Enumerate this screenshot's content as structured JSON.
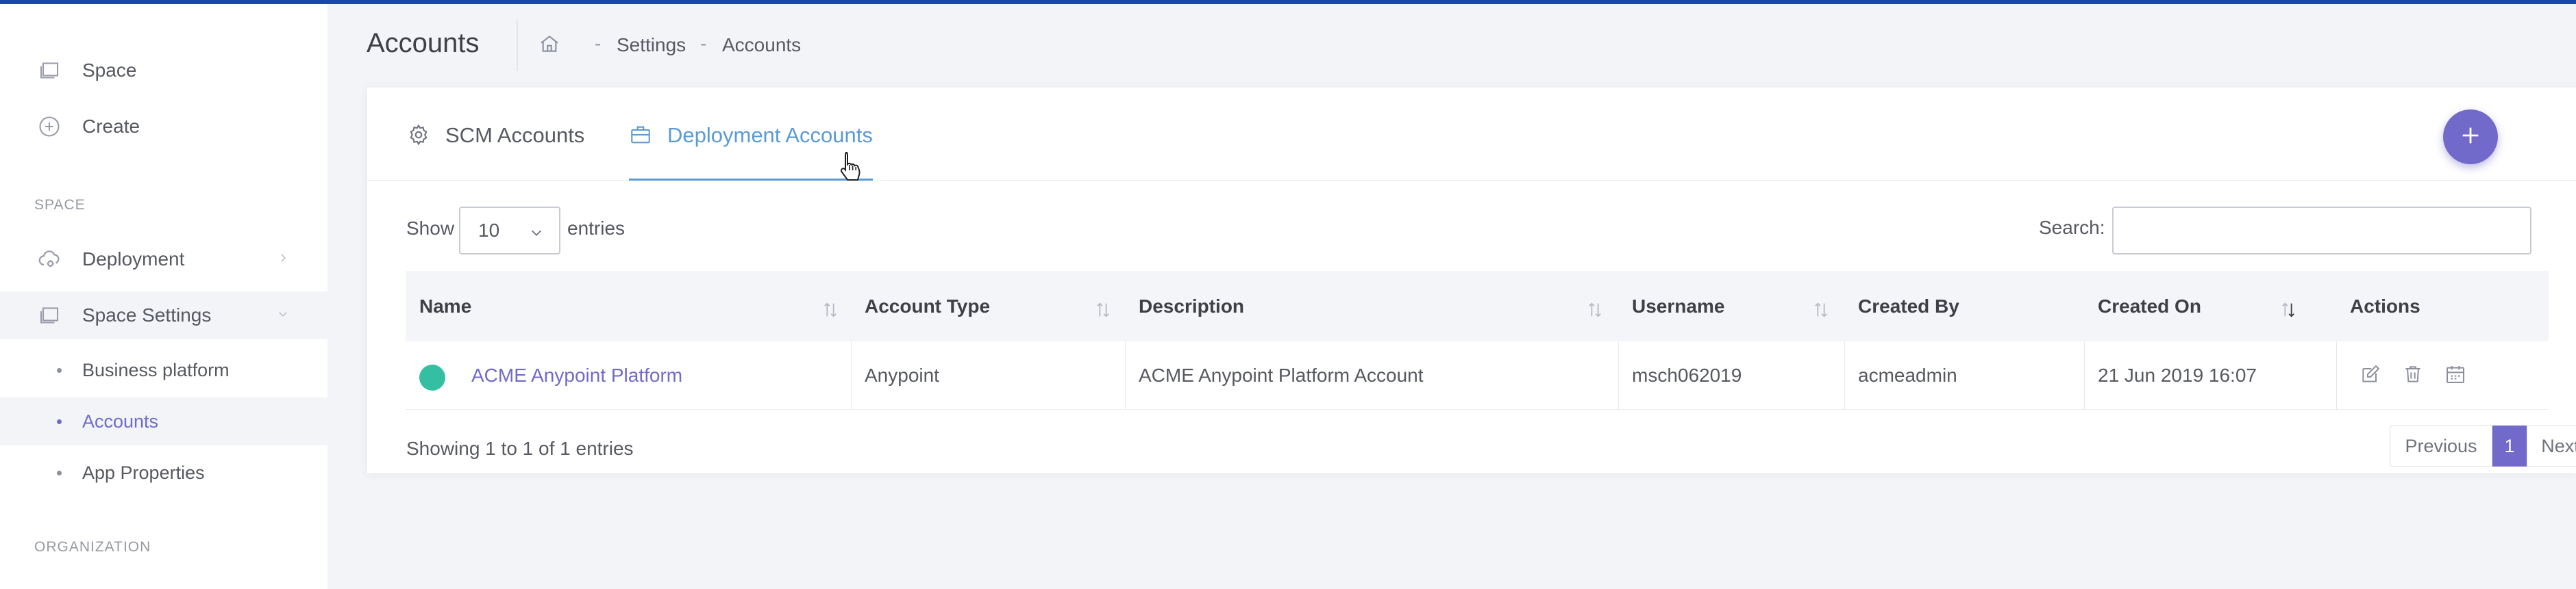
{
  "sidebar": {
    "items": [
      {
        "label": "Space",
        "icon": "stack-icon"
      },
      {
        "label": "Create",
        "icon": "plus-circle-icon"
      }
    ],
    "section_space": "SPACE",
    "space_items": [
      {
        "label": "Deployment",
        "icon": "cloud-gear-icon"
      },
      {
        "label": "Space Settings",
        "icon": "stack-icon"
      }
    ],
    "sub_items": [
      {
        "label": "Business platform"
      },
      {
        "label": "Accounts"
      },
      {
        "label": "App Properties"
      }
    ],
    "section_org": "ORGANIZATION"
  },
  "header": {
    "title": "Accounts",
    "breadcrumb": [
      "Settings",
      "Accounts"
    ],
    "separator": "-"
  },
  "tabs": [
    {
      "label": "SCM Accounts",
      "icon": "gear-icon",
      "active": false
    },
    {
      "label": "Deployment Accounts",
      "icon": "briefcase-icon",
      "active": true
    }
  ],
  "table_controls": {
    "show_label": "Show",
    "entries_value": "10",
    "entries_label": "entries",
    "search_label": "Search:",
    "search_value": ""
  },
  "table": {
    "columns": [
      "Name",
      "Account Type",
      "Description",
      "Username",
      "Created By",
      "Created On",
      "Actions"
    ],
    "rows": [
      {
        "name": "ACME Anypoint Platform",
        "account_type": "Anypoint",
        "description": "ACME Anypoint Platform Account",
        "username": "msch062019",
        "created_by": "acmeadmin",
        "created_on": "21 Jun 2019 16:07",
        "status_color": "#34bfa3"
      }
    ]
  },
  "footer": {
    "showing": "Showing 1 to 1 of 1 entries",
    "previous": "Previous",
    "current_page": "1",
    "next": "Next"
  },
  "colors": {
    "accent": "#716aca",
    "tab_active": "#5b9bd5",
    "top_bar": "#1a47a8",
    "status_active": "#34bfa3"
  }
}
